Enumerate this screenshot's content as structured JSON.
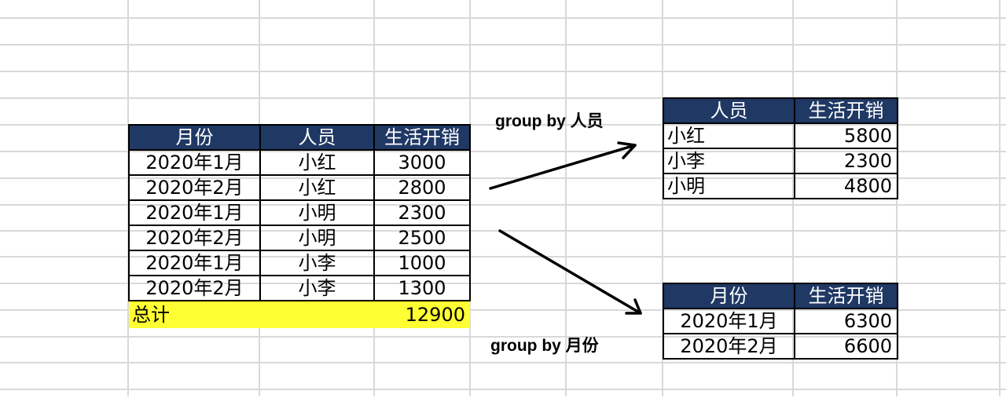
{
  "main_table": {
    "headers": [
      "月份",
      "人员",
      "生活开销"
    ],
    "rows": [
      [
        "2020年1月",
        "小红",
        "3000"
      ],
      [
        "2020年2月",
        "小红",
        "2800"
      ],
      [
        "2020年1月",
        "小明",
        "2300"
      ],
      [
        "2020年2月",
        "小明",
        "2500"
      ],
      [
        "2020年1月",
        "小李",
        "1000"
      ],
      [
        "2020年2月",
        "小李",
        "1300"
      ]
    ],
    "total_label": "总计",
    "total_value": "12900",
    "total_highlight_color": "#ffff33"
  },
  "group_person": {
    "label": "group by 人员",
    "headers": [
      "人员",
      "生活开销"
    ],
    "rows": [
      [
        "小红",
        "5800"
      ],
      [
        "小李",
        "2300"
      ],
      [
        "小明",
        "4800"
      ]
    ]
  },
  "group_month": {
    "label": "group by 月份",
    "headers": [
      "月份",
      "生活开销"
    ],
    "rows": [
      [
        "2020年1月",
        "6300"
      ],
      [
        "2020年2月",
        "6600"
      ]
    ]
  },
  "colors": {
    "header_bg": "#1f3864",
    "header_text": "#ffffff",
    "gridline": "#d9d9d9"
  },
  "icons": [
    "arrow-up-right-icon",
    "arrow-down-right-icon"
  ]
}
